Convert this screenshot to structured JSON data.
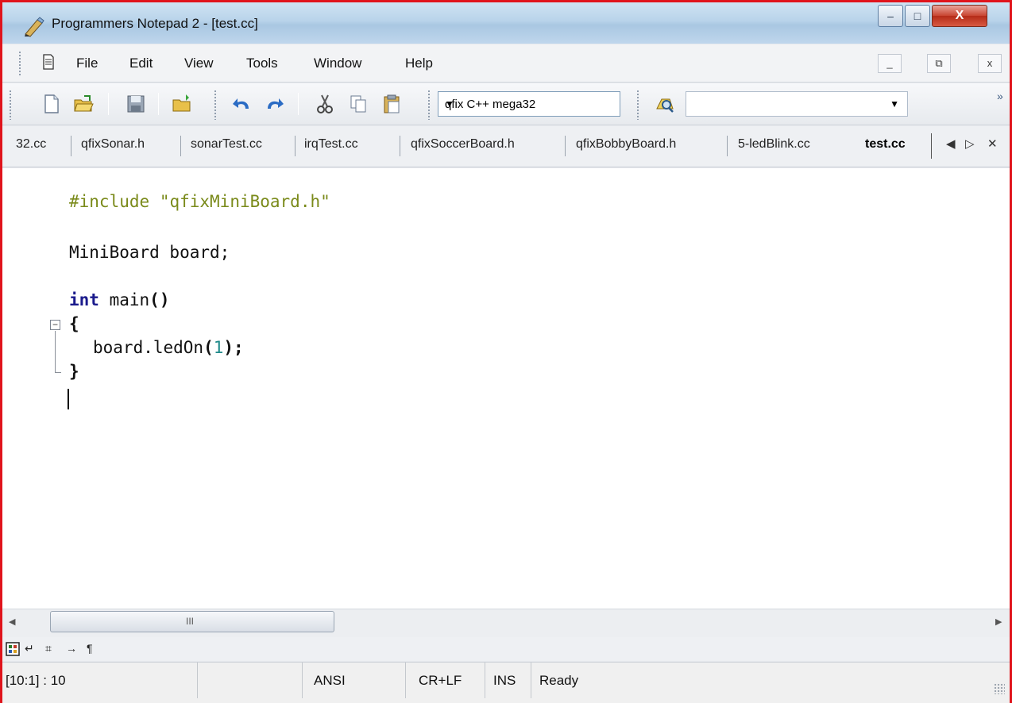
{
  "window": {
    "title": "Programmers Notepad 2 - [test.cc]",
    "min_glyph": "–",
    "max_glyph": "□",
    "close_glyph": "X"
  },
  "menu": {
    "items": [
      "File",
      "Edit",
      "View",
      "Tools",
      "Window",
      "Help"
    ],
    "mdi_min": "_",
    "mdi_restore": "⧉",
    "mdi_close": "x"
  },
  "toolbar": {
    "scheme": "qfix C++ mega32",
    "find_value": "",
    "overflow": "»"
  },
  "tabs": {
    "items": [
      "32.cc",
      "qfixSonar.h",
      "sonarTest.cc",
      "irqTest.cc",
      "qfixSoccerBoard.h",
      "qfixBobbyBoard.h",
      "5-ledBlink.cc"
    ],
    "active": "test.cc",
    "nav_left": "◀",
    "nav_right": "▷",
    "close": "✕"
  },
  "editor": {
    "include_kw": "#include",
    "include_str": "\"qfixMiniBoard.h\"",
    "line2": "MiniBoard board;",
    "line3_kw": "int",
    "line3_rest": "main",
    "line3_paren": "()",
    "open_brace": "{",
    "call": "board.ledOn",
    "lparen": "(",
    "arg": "1",
    "rparen_semi": ");",
    "close_brace": "}",
    "fold": "−"
  },
  "hscroll": {
    "grip": "III",
    "left_arrow": "◀",
    "right_arrow": "▶"
  },
  "viewbar": {
    "wrap": "↵",
    "grid": "⌗",
    "tabs": "→",
    "para": "¶"
  },
  "status": {
    "position": "[10:1] : 10",
    "encoding": "ANSI",
    "line_endings": "CR+LF",
    "mode": "INS",
    "state": "Ready"
  },
  "colors": {
    "frame": "#e0141c",
    "keyword": "#1a1a8c",
    "string": "#7a8a1a",
    "number": "#1f8a8a"
  }
}
